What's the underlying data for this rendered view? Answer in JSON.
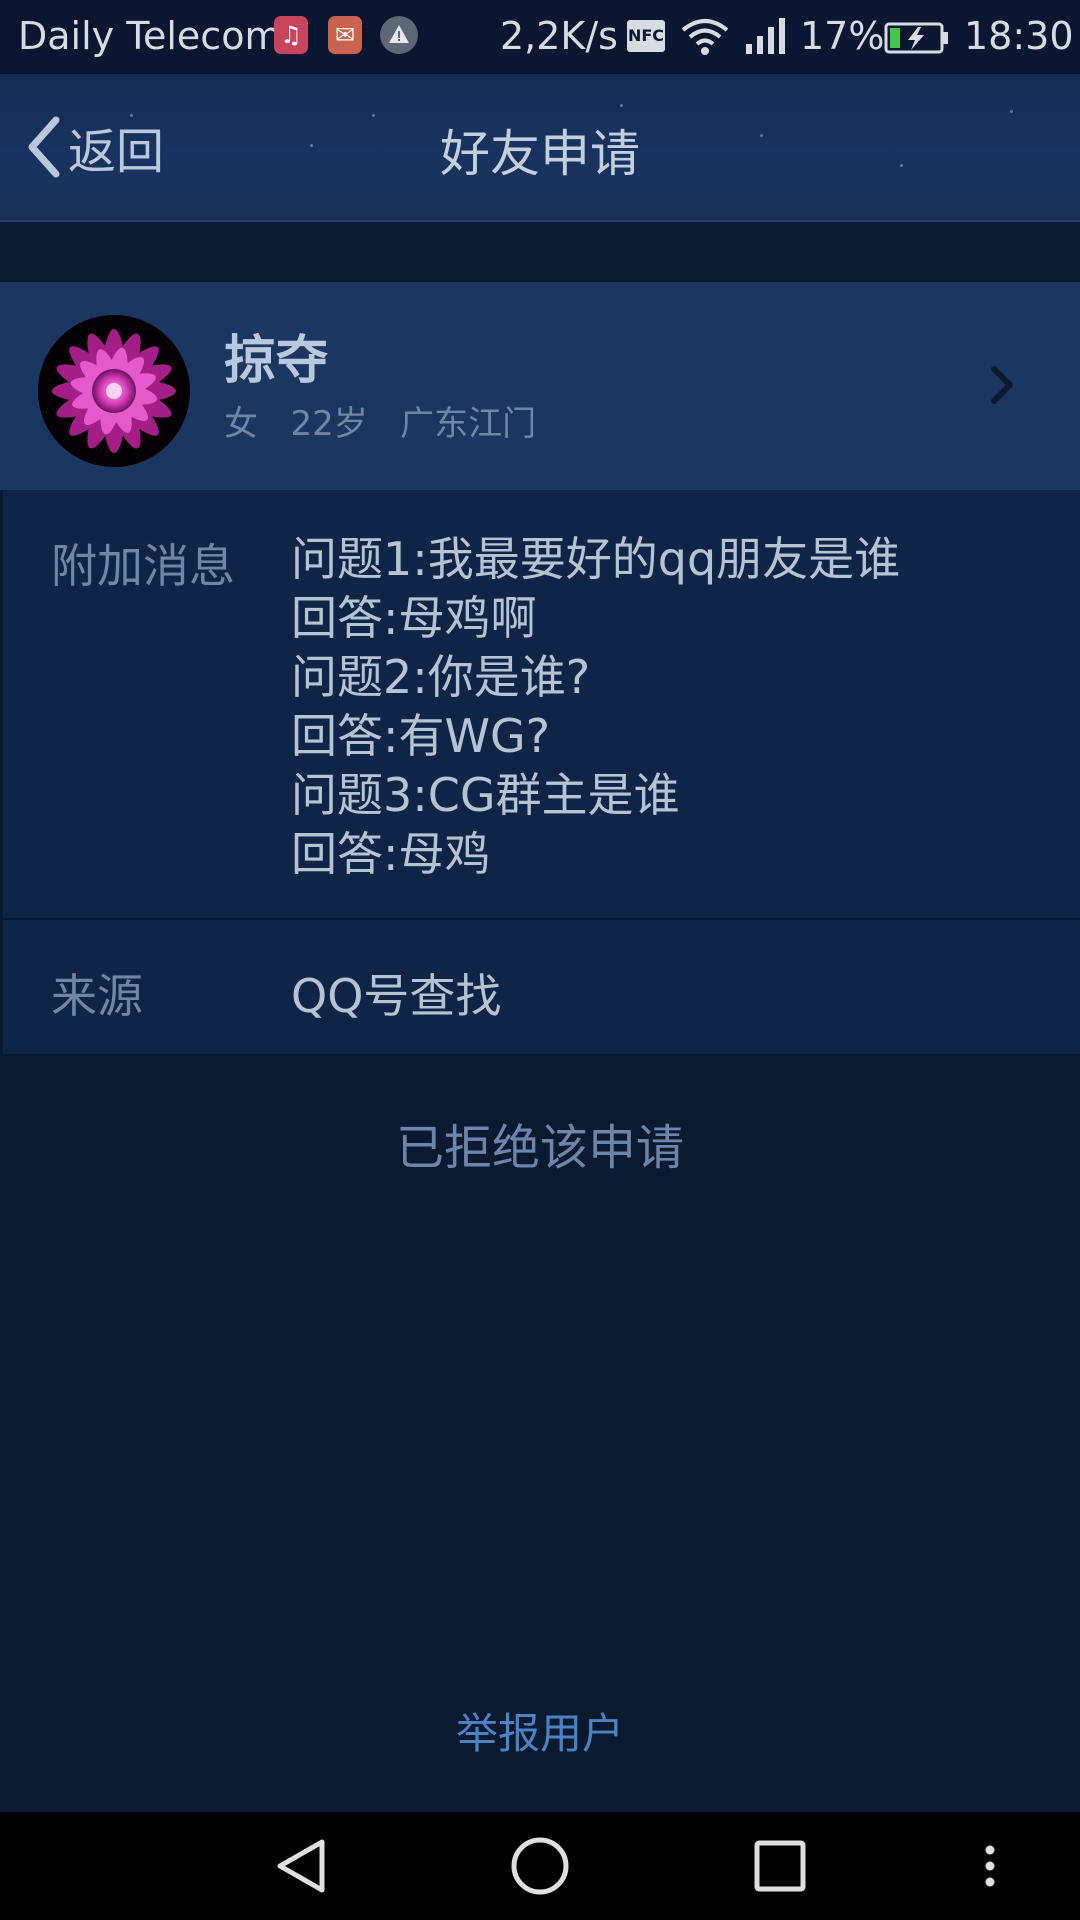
{
  "status_bar": {
    "carrier": "Daily Telecom",
    "notifications": [
      "music-icon",
      "mail-icon",
      "warning-icon"
    ],
    "net_speed": "2,2K/s",
    "nfc_label": "NFC",
    "battery_percent": "17%",
    "time": "18:30"
  },
  "header": {
    "back_label": "返回",
    "title": "好友申请"
  },
  "profile": {
    "name": "掠夺",
    "gender": "女",
    "age": "22岁",
    "location": "广东江门"
  },
  "details": {
    "message_label": "附加消息",
    "message_lines": [
      "问题1:我最要好的qq朋友是谁",
      "回答:母鸡啊",
      "问题2:你是谁?",
      "回答:有WG?",
      "问题3:CG群主是谁",
      "回答:母鸡"
    ],
    "source_label": "来源",
    "source_value": "QQ号查找"
  },
  "status_text": "已拒绝该申请",
  "report_label": "举报用户",
  "colors": {
    "background": "#0c1a31",
    "card": "#1b3660",
    "accent_link": "#4a84c6"
  }
}
